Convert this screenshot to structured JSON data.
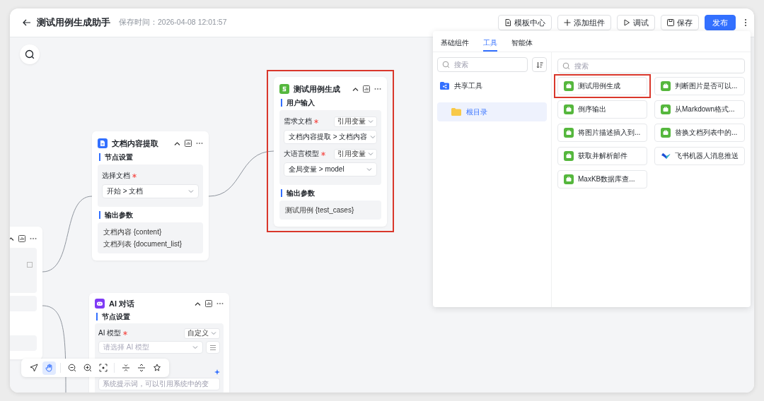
{
  "header": {
    "title": "测试用例生成助手",
    "saved_time": "保存时间：2026-04-08 12:01:57",
    "buttons": [
      {
        "kind": "template",
        "label": "模板中心"
      },
      {
        "kind": "add",
        "label": "添加组件"
      },
      {
        "kind": "debug",
        "label": "调试"
      },
      {
        "kind": "save",
        "label": "保存"
      },
      {
        "kind": "publish",
        "label": "发布"
      }
    ]
  },
  "canvas": {
    "nodes": [
      {
        "kind": "cropped",
        "highlighted": false
      },
      {
        "kind": "document",
        "title": "文档内容提取",
        "highlighted": false,
        "sections": [
          {
            "heading": "节点设置",
            "fields": [
              {
                "kind": "select",
                "label": "选择文档",
                "required": true,
                "value": "开始 > 文档"
              }
            ]
          },
          {
            "heading": "输出参数",
            "outputs": [
              "文档内容 {content}",
              "文档列表 {document_list}"
            ]
          }
        ]
      },
      {
        "kind": "tool",
        "title": "测试用例生成",
        "highlighted": true,
        "sections": [
          {
            "heading": "用户输入",
            "fields": [
              {
                "kind": "select",
                "label": "需求文档",
                "required": true,
                "mode": "引用变量",
                "value": "文档内容提取 > 文档内容"
              },
              {
                "kind": "select",
                "label": "大语言模型",
                "required": true,
                "mode": "引用变量",
                "value": "全局变量 > model"
              }
            ]
          },
          {
            "heading": "输出参数",
            "outputs": [
              "测试用例 {test_cases}"
            ]
          }
        ]
      },
      {
        "kind": "ai",
        "title": "AI 对话",
        "highlighted": false,
        "sections": [
          {
            "heading": "节点设置",
            "fields": [
              {
                "kind": "model",
                "label": "AI 模型",
                "required": true,
                "mode": "自定义",
                "placeholder": "请选择 AI 模型"
              },
              {
                "kind": "prompt",
                "placeholder": "系统提示词，可以引用系统中的变"
              }
            ]
          }
        ]
      }
    ]
  },
  "add_panel": {
    "tabs": [
      {
        "label": "基础组件",
        "selected": false
      },
      {
        "label": "工具",
        "selected": true
      },
      {
        "label": "智能体",
        "selected": false
      }
    ],
    "folder_search": {
      "placeholder": "搜索"
    },
    "folders": [
      {
        "kind": "shared",
        "label": "共享工具",
        "selected": false
      },
      {
        "kind": "folder",
        "label": "根目录",
        "selected": true
      }
    ],
    "tool_search": {
      "placeholder": "搜索"
    },
    "tools": [
      {
        "kind": "app",
        "label": "测试用例生成",
        "highlighted": true
      },
      {
        "kind": "app",
        "label": "判断图片是否可以...",
        "highlighted": false
      },
      {
        "kind": "app",
        "label": "倒序输出",
        "highlighted": false
      },
      {
        "kind": "app",
        "label": "从Markdown格式...",
        "highlighted": false
      },
      {
        "kind": "app",
        "label": "将图片描述插入到...",
        "highlighted": false
      },
      {
        "kind": "app",
        "label": "替换文档列表中的...",
        "highlighted": false
      },
      {
        "kind": "app",
        "label": "获取并解析邮件",
        "highlighted": false
      },
      {
        "kind": "feishu",
        "label": "飞书机器人消息推送",
        "highlighted": false
      },
      {
        "kind": "app",
        "label": "MaxKB数据库查...",
        "highlighted": false
      }
    ]
  },
  "toolbar": {
    "tools": [
      {
        "kind": "pointer",
        "selected": false
      },
      {
        "kind": "hand",
        "selected": true
      },
      {
        "kind": "zoom-out",
        "selected": false
      },
      {
        "kind": "zoom-in",
        "selected": false
      },
      {
        "kind": "fit",
        "selected": false
      },
      {
        "kind": "collapse",
        "selected": false
      },
      {
        "kind": "expand",
        "selected": false
      },
      {
        "kind": "beautify",
        "selected": false
      }
    ]
  }
}
